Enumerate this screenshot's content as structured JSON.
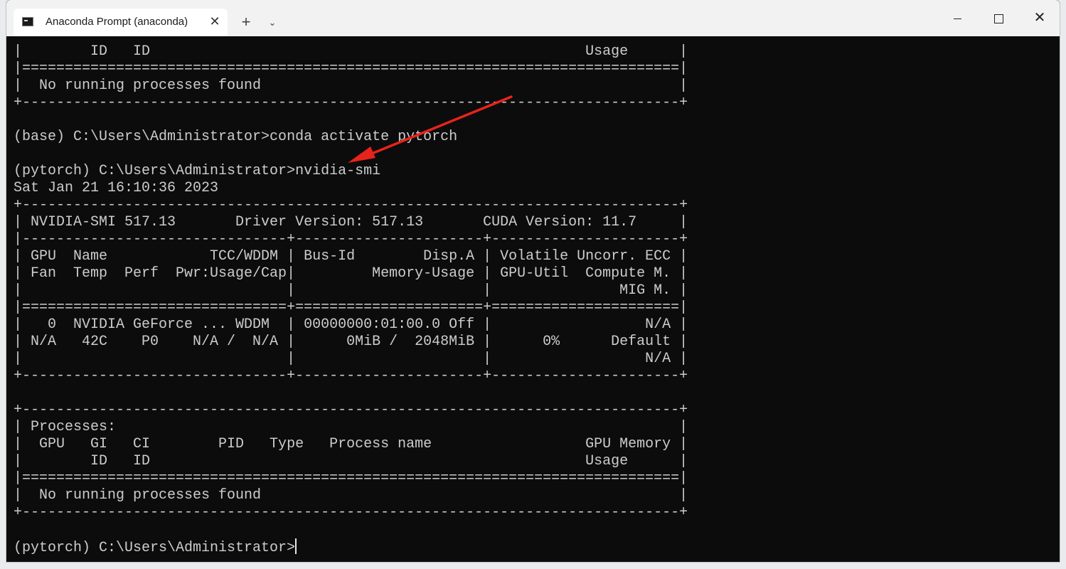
{
  "window": {
    "tab_title": "Anaconda Prompt (anaconda)",
    "tab_close": "✕",
    "new_tab": "+",
    "tab_menu": "⌄",
    "close_glyph": "✕"
  },
  "terminal": {
    "lines": [
      "|        ID   ID                                                   Usage      |",
      "|=============================================================================|",
      "|  No running processes found                                                 |",
      "+-----------------------------------------------------------------------------+",
      "",
      "(base) C:\\Users\\Administrator>conda activate pytorch",
      "",
      "(pytorch) C:\\Users\\Administrator>nvidia-smi",
      "Sat Jan 21 16:10:36 2023",
      "+-----------------------------------------------------------------------------+",
      "| NVIDIA-SMI 517.13       Driver Version: 517.13       CUDA Version: 11.7     |",
      "|-------------------------------+----------------------+----------------------+",
      "| GPU  Name            TCC/WDDM | Bus-Id        Disp.A | Volatile Uncorr. ECC |",
      "| Fan  Temp  Perf  Pwr:Usage/Cap|         Memory-Usage | GPU-Util  Compute M. |",
      "|                               |                      |               MIG M. |",
      "|===============================+======================+======================|",
      "|   0  NVIDIA GeForce ... WDDM  | 00000000:01:00.0 Off |                  N/A |",
      "| N/A   42C    P0    N/A /  N/A |      0MiB /  2048MiB |      0%      Default |",
      "|                               |                      |                  N/A |",
      "+-------------------------------+----------------------+----------------------+",
      "",
      "+-----------------------------------------------------------------------------+",
      "| Processes:                                                                  |",
      "|  GPU   GI   CI        PID   Type   Process name                  GPU Memory |",
      "|        ID   ID                                                   Usage      |",
      "|=============================================================================|",
      "|  No running processes found                                                 |",
      "+-----------------------------------------------------------------------------+",
      "",
      "(pytorch) C:\\Users\\Administrator>"
    ]
  },
  "colors": {
    "terminal_bg": "#0c0c0c",
    "terminal_fg": "#cccccc",
    "annotation_arrow": "#e8231c"
  },
  "icons": {
    "tab": "terminal-icon",
    "minimize": "minimize-icon",
    "maximize": "maximize-icon",
    "close": "close-icon",
    "annotation": "red-arrow-annotation"
  }
}
